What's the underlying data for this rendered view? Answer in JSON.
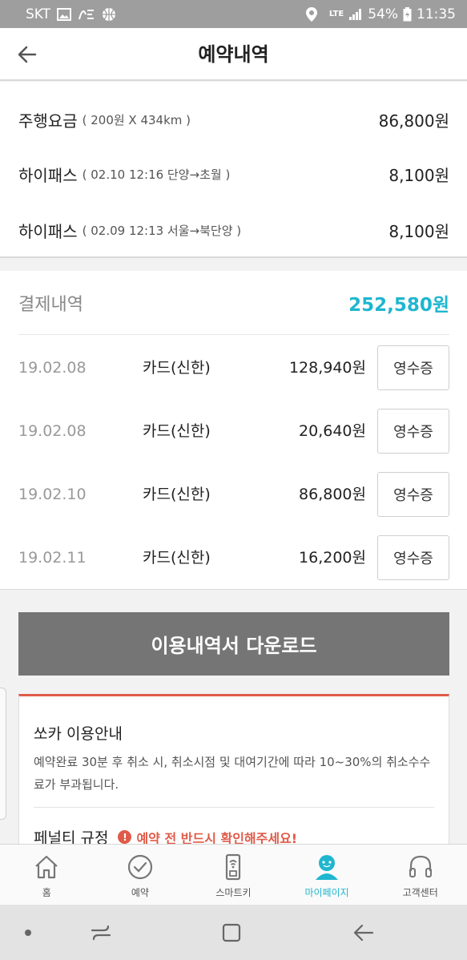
{
  "status_bar": {
    "carrier": "SKT",
    "network": "LTE",
    "battery": "54%",
    "time": "11:35"
  },
  "header": {
    "title": "예약내역"
  },
  "fares": [
    {
      "name": "주행요금",
      "detail": "( 200원 X 434km )",
      "amount": "86,800원"
    },
    {
      "name": "하이패스",
      "detail": "( 02.10 12:16 단양→초월 )",
      "amount": "8,100원"
    },
    {
      "name": "하이패스",
      "detail": "( 02.09 12:13 서울→북단양 )",
      "amount": "8,100원"
    }
  ],
  "payment": {
    "label": "결제내역",
    "total": "252,580원",
    "rows": [
      {
        "date": "19.02.08",
        "method": "카드(신한)",
        "amount": "128,940원",
        "receipt": "영수증"
      },
      {
        "date": "19.02.08",
        "method": "카드(신한)",
        "amount": "20,640원",
        "receipt": "영수증"
      },
      {
        "date": "19.02.10",
        "method": "카드(신한)",
        "amount": "86,800원",
        "receipt": "영수증"
      },
      {
        "date": "19.02.11",
        "method": "카드(신한)",
        "amount": "16,200원",
        "receipt": "영수증"
      }
    ]
  },
  "download": {
    "label": "이용내역서 다운로드"
  },
  "info": {
    "title": "쏘카 이용안내",
    "body": "예약완료 30분 후 취소 시, 취소시점 및 대여기간에 따라 10~30%의 취소수수료가 부과됩니다.",
    "penalty_title": "페널티 규정",
    "warning_icon_text": "!",
    "warning": "예약 전 반드시 확인해주세요!"
  },
  "bottom_nav": {
    "items": [
      {
        "label": "홈",
        "icon": "home-icon"
      },
      {
        "label": "예약",
        "icon": "clock-icon"
      },
      {
        "label": "스마트키",
        "icon": "smartkey-icon"
      },
      {
        "label": "마이페이지",
        "icon": "mypage-icon",
        "active": true
      },
      {
        "label": "고객센터",
        "icon": "headset-icon"
      }
    ]
  },
  "colors": {
    "accent": "#1fb6cf",
    "warning": "#e05a49",
    "download_bg": "#757575",
    "status_bar_bg": "#9e9e9e"
  }
}
